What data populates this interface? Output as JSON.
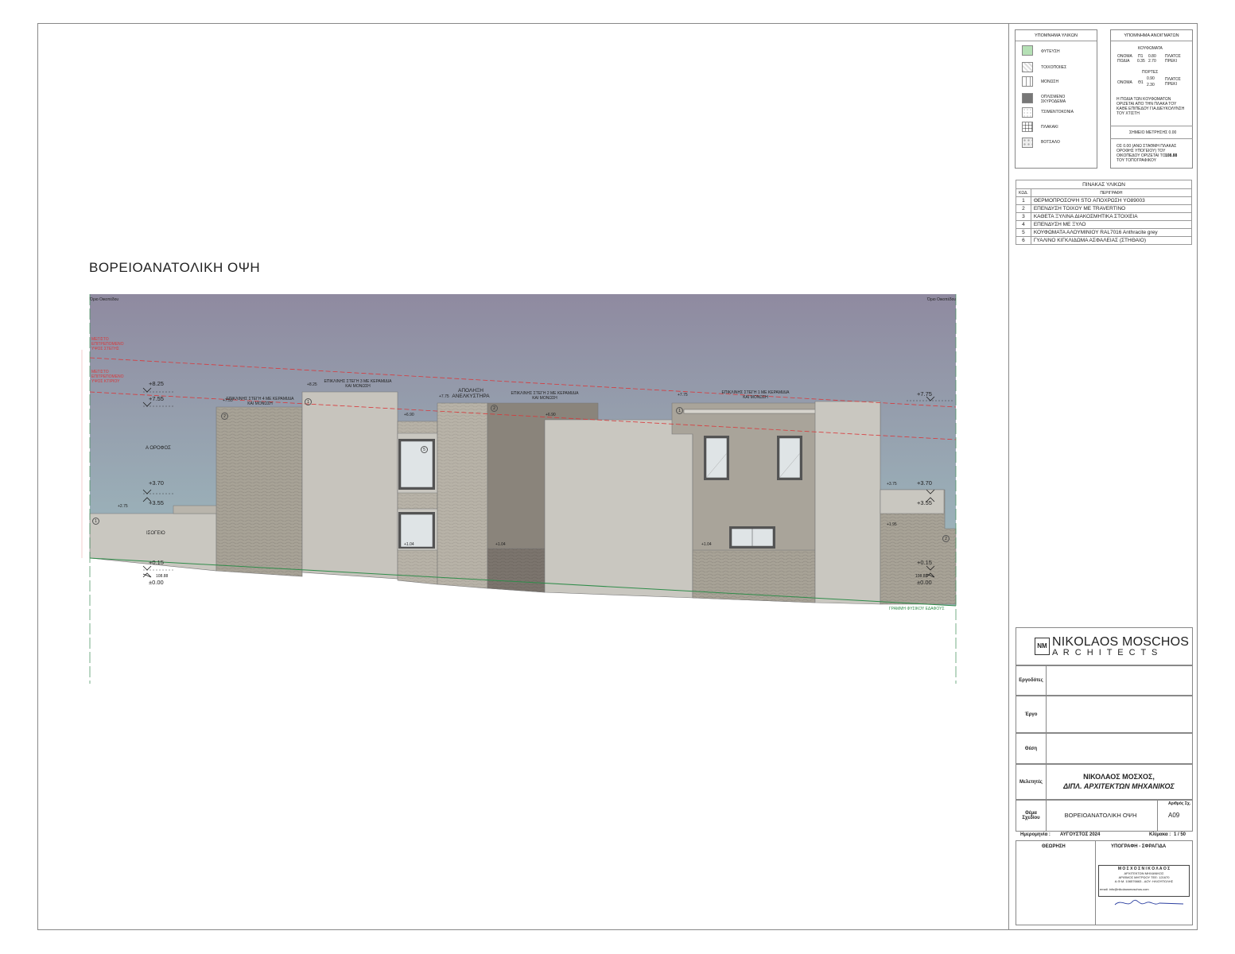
{
  "drawing_title": "ΒΟΡΕΙΟΑΝΑΤΟΛΙΚΗ ΟΨΗ",
  "elevation": {
    "plot_limit_left": "Όριο Οικοπέδου",
    "plot_limit_right": "Όριο Οικοπέδου",
    "max_height_top": "ΜΕΓΙΣΤΟ ΕΠΙΤΡΕΠΟΜΕΝΟ ΥΨΟΣ ΣΤΕΓΗΣ",
    "max_height_bottom": "ΜΕΓΙΣΤΟ ΕΠΙΤΡΕΠΟΜΕΝΟ ΥΨΟΣ ΚΤΙΡΙΟΥ",
    "ground_line": "ΓΡΑΜΜΗ ΦΥΣΙΚΟΥ ΕΔΑΦΟΥΣ",
    "floor_upper": "Α ΟΡΟΦΟΣ",
    "floor_ground": "ΙΣΟΓΕΙΟ",
    "elevator_label": "ΑΠΟΛΗΞΗ ΑΝΕΛΚΥΣΤΗΡΑ",
    "roof4": "ΕΠΙΚΛΙΝΗΣ ΣΤΕΓΗ 4 ΜΕ ΚΕΡΑΜΙΔΙΑ ΚΑΙ ΜΟΝΩΣΗ",
    "roof3": "ΕΠΙΚΛΙΝΗΣ ΣΤΕΓΗ 3 ΜΕ ΚΕΡΑΜΙΔΙΑ ΚΑΙ ΜΟΝΩΣΗ",
    "roof2": "ΕΠΙΚΛΙΝΗΣ ΣΤΕΓΗ 2 ΜΕ ΚΕΡΑΜΙΔΙΑ ΚΑΙ ΜΟΝΩΣΗ",
    "roof1": "ΕΠΙΚΛΙΝΗΣ ΣΤΕΓΗ 1 ΜΕ ΚΕΡΑΜΙΔΙΑ ΚΑΙ ΜΟΝΩΣΗ",
    "levels_left": [
      "+8.25",
      "+7.55",
      "+3.70",
      "+3.55",
      "+0.15",
      "108.88",
      "±0.00"
    ],
    "levels_right": [
      "+7.75",
      "+3.70",
      "+3.55",
      "+0.15",
      "108.88",
      "±0.00"
    ],
    "small_levels": {
      "a": "+2.75",
      "b": "+7.55",
      "c": "+8.25",
      "d": "+7.75",
      "e": "+6.90",
      "f": "+6.90",
      "g": "+7.75",
      "h": "+3.75",
      "i": "+1.95",
      "j": "+1.04",
      "k": "+1.04",
      "l": "+1.04"
    },
    "tags": [
      "1",
      "2",
      "1",
      "2",
      "1",
      "5",
      "2"
    ]
  },
  "materials_legend": {
    "title": "ΥΠΟΜΝΗΜΑ ΥΛΙΚΩΝ",
    "items": [
      "ΦΥΤΕΥΣΗ",
      "ΤΟΙΧΟΠΟΙΙΕΣ",
      "ΜΟΝΩΣΗ",
      "ΟΠΛΙΣΜΕΝΟ ΣΚΥΡΟΔΕΜΑ",
      "ΤΣΙΜΕΝΤΟΚΟΝΙΑ",
      "ΠΛΑΚΑΚΙ",
      "ΒΟΤΣΑΛΟ"
    ]
  },
  "openings_legend": {
    "title": "ΥΠΟΜΝΗΜΑ ΑΝΟΙΓΜΑΤΩΝ",
    "windows": "ΚΟΥΦΩΜΑΤΑ",
    "win_row1": [
      "ΟΝΟΜΑ",
      "Π1",
      "0.80",
      "ΠΛΑΤΟΣ"
    ],
    "win_row2": [
      "ΠΟΔΙΑ",
      "0.35",
      "2.70",
      "ΠΡΕΚΙ"
    ],
    "doors": "ΠΟΡΤΕΣ",
    "door_row": [
      "ΟΝΟΜΑ",
      "Θ1",
      "0.90",
      "2.30",
      "ΠΛΑΤΟΣ",
      "ΠΡΕΚΙ"
    ],
    "note": "Η ΠΟΔΙΑ ΤΩΝ ΚΟΥΦΩΜΑΤΩΝ ΟΡΙΖΕΤΑΙ ΑΠΟ ΤΗΝ ΠΛΑΚΑ ΤΟΥ ΚΑΘΕ ΕΠΙΠΕΔΟΥ ΓΙΑ ΔΙΕΥΚΟΛΥΝΣΗ ΤΟΥ ΧΤΙΣΤΗ",
    "datum": "ΣΗΜΕΙΟ ΜΕΤΡΗΣΗΣ 0.00",
    "datum_note": "ΟΣ 0.00 (ΑΝΩ ΣΤΑΘΜΗ ΠΛΑΚΑΣ ΟΡΟΦΗΣ ΥΠΟΓΕΙΟΥ) ΤΟΥ ΟΙΚΟΠΕΔΟΥ ΟΡΙΖΕΤΑΙ ΤΟ",
    "datum_value": "108.88",
    "datum_tail": "ΤΟΥ ΤΟΠΟΓΡΑΦΙΚΟΥ"
  },
  "materials_table": {
    "title": "ΠΙΝΑΚΑΣ ΥΛΙΚΩΝ",
    "col_code": "ΚΩΔ.",
    "col_desc": "ΠΕΡΙΓΡΑΦΗ",
    "rows": [
      {
        "code": "1",
        "desc": "ΘΕΡΜΟΠΡΟΣΟΨΗ  STO ΑΠΟΧΡΩΣΗ YO89003"
      },
      {
        "code": "2",
        "desc": "ΕΠΕΝΔΥΣΗ ΤΟΙΧΟΥ ΜΕ TRAVERTINO"
      },
      {
        "code": "3",
        "desc": "ΚΑΘΕΤΑ ΞΥΛΙΝΑ ΔΙΑΚΟΣΜΗΤΙΚΑ ΣΤΟΙΧΕΙΑ"
      },
      {
        "code": "4",
        "desc": "ΕΠΕΝΔΥΣΗ ΜΕ ΞΥΛΟ"
      },
      {
        "code": "5",
        "desc": "ΚΟΥΦΩΜΑΤΑ ΑΛΟΥΜΙΝΙΟΥ RAL7016 Anthracite grey"
      },
      {
        "code": "6",
        "desc": "ΓΥΑΛΙΝΟ ΚΙΓΚΛΙΔΩΜΑ ΑΣΦΑΛΕΙΑΣ (ΣΤΗΘΑΙΟ)"
      }
    ]
  },
  "title_block": {
    "logo_mark": "NM",
    "company_name": "NIKOLAOS MOSCHOS",
    "company_sub": "A R C H I T E C T S",
    "employer_label": "Εργοδότες",
    "project_label": "Έργο",
    "location_label": "Θέση",
    "designers_label": "Μελετητές",
    "designer_name": "ΝΙΚΟΛΑΟΣ ΜΟΣΧΟΣ,",
    "designer_title": "ΔΙΠΛ. ΑΡΧΙΤΕΚΤΩΝ ΜΗΧΑΝΙΚΟΣ",
    "drawing_subject_label": "Θέμα Σχεδίου",
    "drawing_subject": "ΒΟΡΕΙΟΑΝΑΤΟΛΙΚΗ ΟΨΗ",
    "drawing_no_label": "Αριθμός Σχ.",
    "drawing_no": "Α09",
    "date_label": "Ημερομηνία :",
    "date_value": "ΑΥΓΟΥΣΤΟΣ 2024",
    "scale_label": "Κλίμακα :",
    "scale_value": "1 / 50",
    "approval_label": "ΘΕΩΡΗΣΗ",
    "signature_label": "ΥΠΟΓΡΑΦΗ - ΣΦΡΑΓΙΔΑ",
    "stamp_line1": "Μ Ο Σ Χ Ο Σ   Ν Ι Κ Ο Λ Α Ο Σ",
    "stamp_line2": "ΑΡΧΙΤΕΚΤΩΝ ΜΗΧΑΝΙΚΟΣ",
    "stamp_line3": "ΑΡΙΘΜΟΣ ΜΗΤΡΩΟΥ ΤΕΕ: 121670",
    "stamp_line4": "Α.Φ.Μ. 106576663 - ΔΟΥ: ΗΛΙΟΥΠΟΛΗΣ",
    "stamp_line5": "email: info@nikolaosmoschos.com"
  },
  "colors": {
    "sky_top": "#8f8aa0",
    "sky_bottom": "#9fb9bf",
    "wall_light": "#c9c7c0",
    "wall_mid": "#a9a49a",
    "wall_dark": "#8a847b",
    "roof_dark": "#7e776f",
    "limit_red": "#d9383a",
    "ground_green": "#2f8c4a"
  }
}
